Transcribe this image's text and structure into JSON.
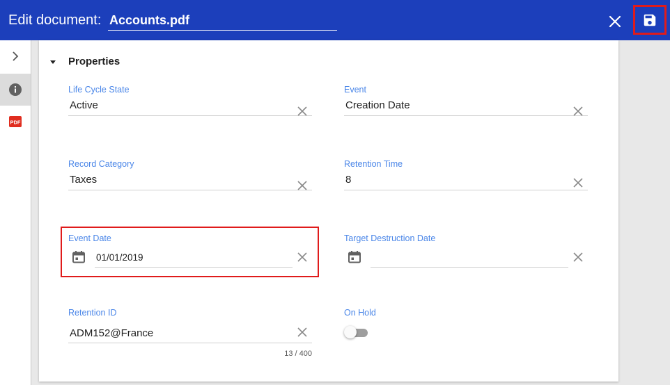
{
  "header": {
    "title": "Edit document:",
    "document_name": "Accounts.pdf"
  },
  "rail": {
    "items": [
      {
        "icon": "chevron-right-icon"
      },
      {
        "icon": "info-icon",
        "active": true
      },
      {
        "icon": "pdf-icon",
        "badge": "PDF"
      }
    ]
  },
  "section": {
    "title": "Properties"
  },
  "fields": {
    "life_cycle_state": {
      "label": "Life Cycle State",
      "value": "Active"
    },
    "event": {
      "label": "Event",
      "value": "Creation Date"
    },
    "record_category": {
      "label": "Record Category",
      "value": "Taxes"
    },
    "retention_time": {
      "label": "Retention Time",
      "value": "8"
    },
    "event_date": {
      "label": "Event Date",
      "value": "01/01/2019"
    },
    "target_destruction_date": {
      "label": "Target Destruction Date",
      "value": ""
    },
    "retention_id": {
      "label": "Retention ID",
      "value": "ADM152@France",
      "counter": "13 / 400"
    },
    "on_hold": {
      "label": "On Hold",
      "checked": false
    }
  },
  "colors": {
    "header_bg": "#1c3fbb",
    "label": "#4a86e8",
    "highlight": "#e01b1b"
  }
}
